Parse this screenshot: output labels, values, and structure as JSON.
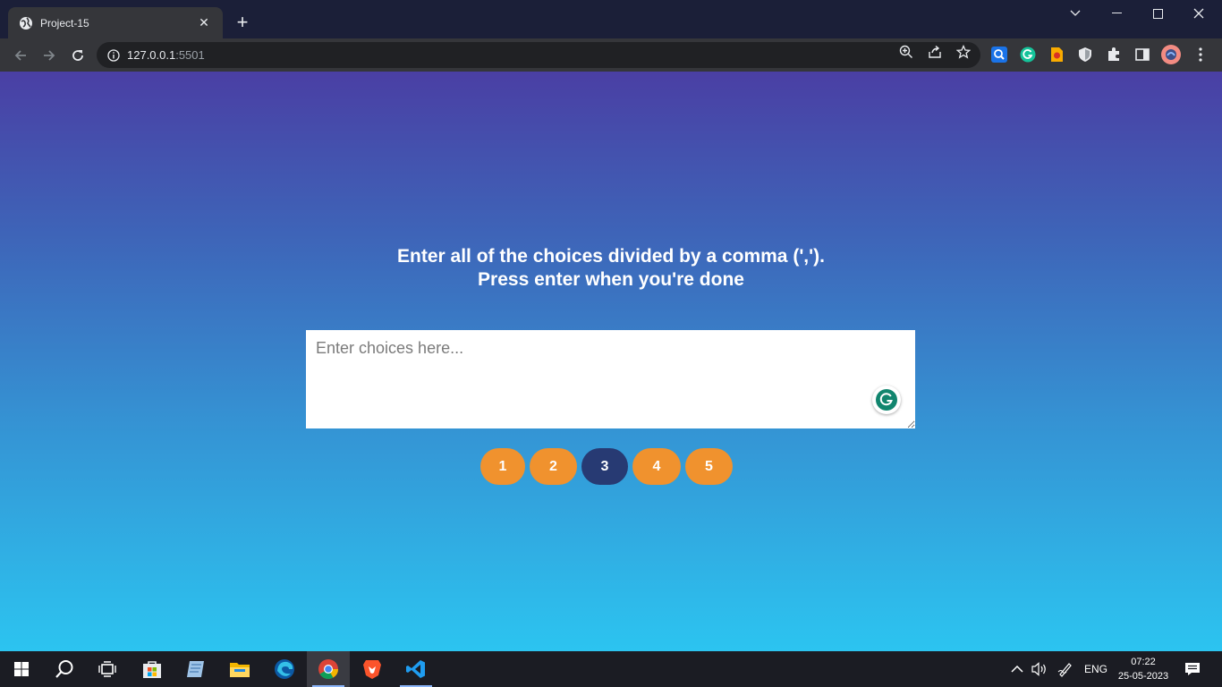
{
  "browser": {
    "tab_title": "Project-15",
    "close_tab_glyph": "✕",
    "new_tab_glyph": "+",
    "url_host": "127.0.0.1",
    "url_port": ":5501"
  },
  "page": {
    "heading_line1": "Enter all of the choices divided by a comma (',').",
    "heading_line2": "Press enter when you're done",
    "textarea_placeholder": "Enter choices here...",
    "textarea_value": "",
    "pills": [
      {
        "label": "1",
        "active": false
      },
      {
        "label": "2",
        "active": false
      },
      {
        "label": "3",
        "active": true
      },
      {
        "label": "4",
        "active": false
      },
      {
        "label": "5",
        "active": false
      }
    ]
  },
  "taskbar": {
    "language": "ENG",
    "time": "07:22",
    "date": "25-05-2023"
  },
  "colors": {
    "pill_orange": "#f0922e",
    "pill_active": "#273a73",
    "gradient_top": "#4a3fa4",
    "gradient_bottom": "#2cc4f0"
  }
}
